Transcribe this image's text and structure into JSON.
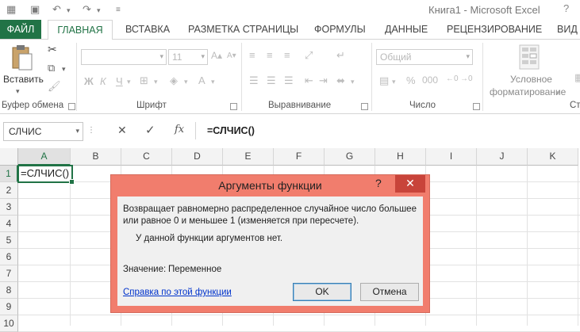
{
  "window": {
    "title": "Книга1 - Microsoft Excel",
    "help_glyph": "?"
  },
  "ribbon": {
    "tabs": [
      {
        "label": "ФАЙЛ"
      },
      {
        "label": "ГЛАВНАЯ"
      },
      {
        "label": "ВСТАВКА"
      },
      {
        "label": "РАЗМЕТКА СТРАНИЦЫ"
      },
      {
        "label": "ФОРМУЛЫ"
      },
      {
        "label": "ДАННЫЕ"
      },
      {
        "label": "РЕЦЕНЗИРОВАНИЕ"
      },
      {
        "label": "ВИД"
      }
    ],
    "paste_label": "Вставить",
    "font_size": "11",
    "number_format": "Общий",
    "bold": "Ж",
    "italic": "К",
    "underline": "Ч",
    "conditional_format": [
      "Условное",
      "форматирование"
    ],
    "groups": {
      "clipboard": "Буфер обмена",
      "font": "Шрифт",
      "alignment": "Выравнивание",
      "number": "Число",
      "styles": "Ст"
    }
  },
  "formula_bar": {
    "name_box": "СЛЧИС",
    "fx": "fx",
    "content": "=СЛЧИС()"
  },
  "grid": {
    "columns": [
      "A",
      "B",
      "C",
      "D",
      "E",
      "F",
      "G",
      "H",
      "I",
      "J",
      "K"
    ],
    "rows": [
      "1",
      "2",
      "3",
      "4",
      "5",
      "6",
      "7",
      "8",
      "9",
      "10"
    ],
    "active_cell_text": "=СЛЧИС()"
  },
  "dialog": {
    "title": "Аргументы функции",
    "help": "?",
    "close": "✕",
    "description": "Возвращает равномерно распределенное случайное число большее или равное 0 и меньшее 1 (изменяется при пересчете).",
    "no_args": "У данной функции аргументов нет.",
    "value_label": "Значение:",
    "value": "Переменное",
    "help_link": "Справка по этой функции",
    "ok": "OK",
    "cancel": "Отмена"
  },
  "colors": {
    "excel_green": "#217346",
    "dialog_border": "#f17d6d",
    "close_button": "#c8443a"
  }
}
